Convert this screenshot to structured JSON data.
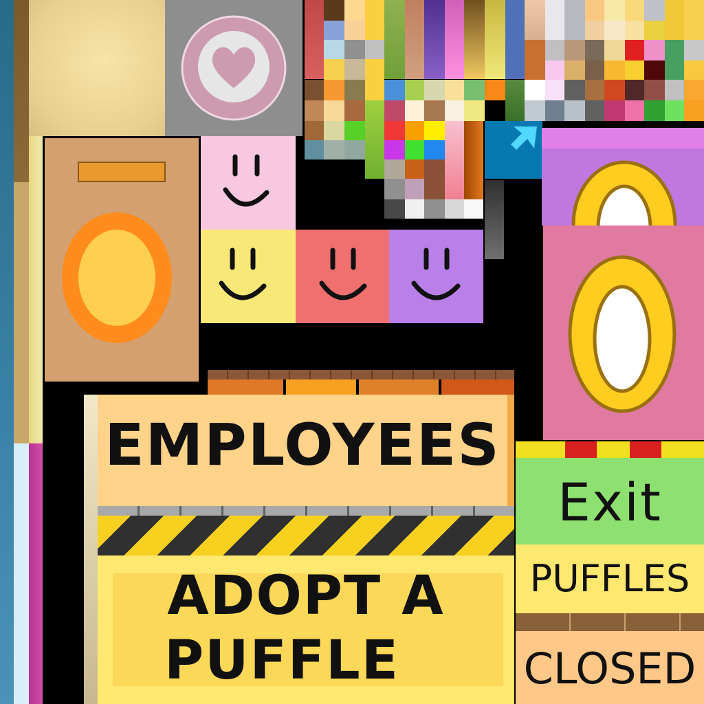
{
  "signs": {
    "employees": "EMPLOYEES",
    "exit": "Exit",
    "adopt_line1": "ADOPT A",
    "adopt_line2": "PUFFLE",
    "puffles": "PUFFLES",
    "closed": "CLOSED"
  },
  "icons": {
    "heart": "heart-icon",
    "smiley": "smiley-face-icon",
    "cursor": "arrow-cursor-icon",
    "door_ring": "door-ring-icon"
  },
  "colors": {
    "smiley_pink": "#f8c8e0",
    "smiley_yellow": "#f8e878",
    "smiley_red": "#f07070",
    "smiley_purple": "#b880e8",
    "door_tan": "#d4a070",
    "ring_orange": "#ff8c1c",
    "ring_yellow": "#ffd050",
    "sign_employees": "#ffd38a",
    "sign_adopt": "#ffe870",
    "sign_exit": "#8ee070",
    "sign_closed": "#ffc888",
    "pink_panel": "#e07aa0",
    "lilac_panel": "#c078e0"
  }
}
